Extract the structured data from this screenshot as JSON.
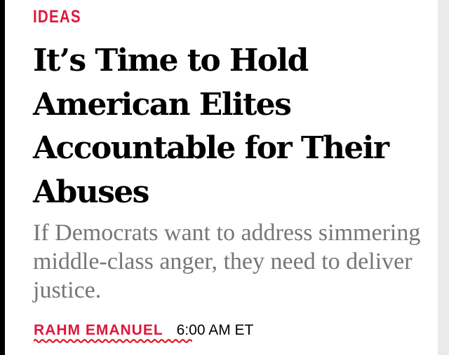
{
  "article": {
    "section": "IDEAS",
    "headline": "It’s Time to Hold American Elites Accountable for Their Abuses",
    "dek": "If Democrats want to address simmering middle-class anger, they need to deliver justice.",
    "author": "RAHM EMANUEL",
    "time": "6:00 AM ET"
  },
  "colors": {
    "accent": "#e0153c",
    "headline": "#000000",
    "dek": "#767676",
    "spellcheck_underline": "#e8141c"
  }
}
